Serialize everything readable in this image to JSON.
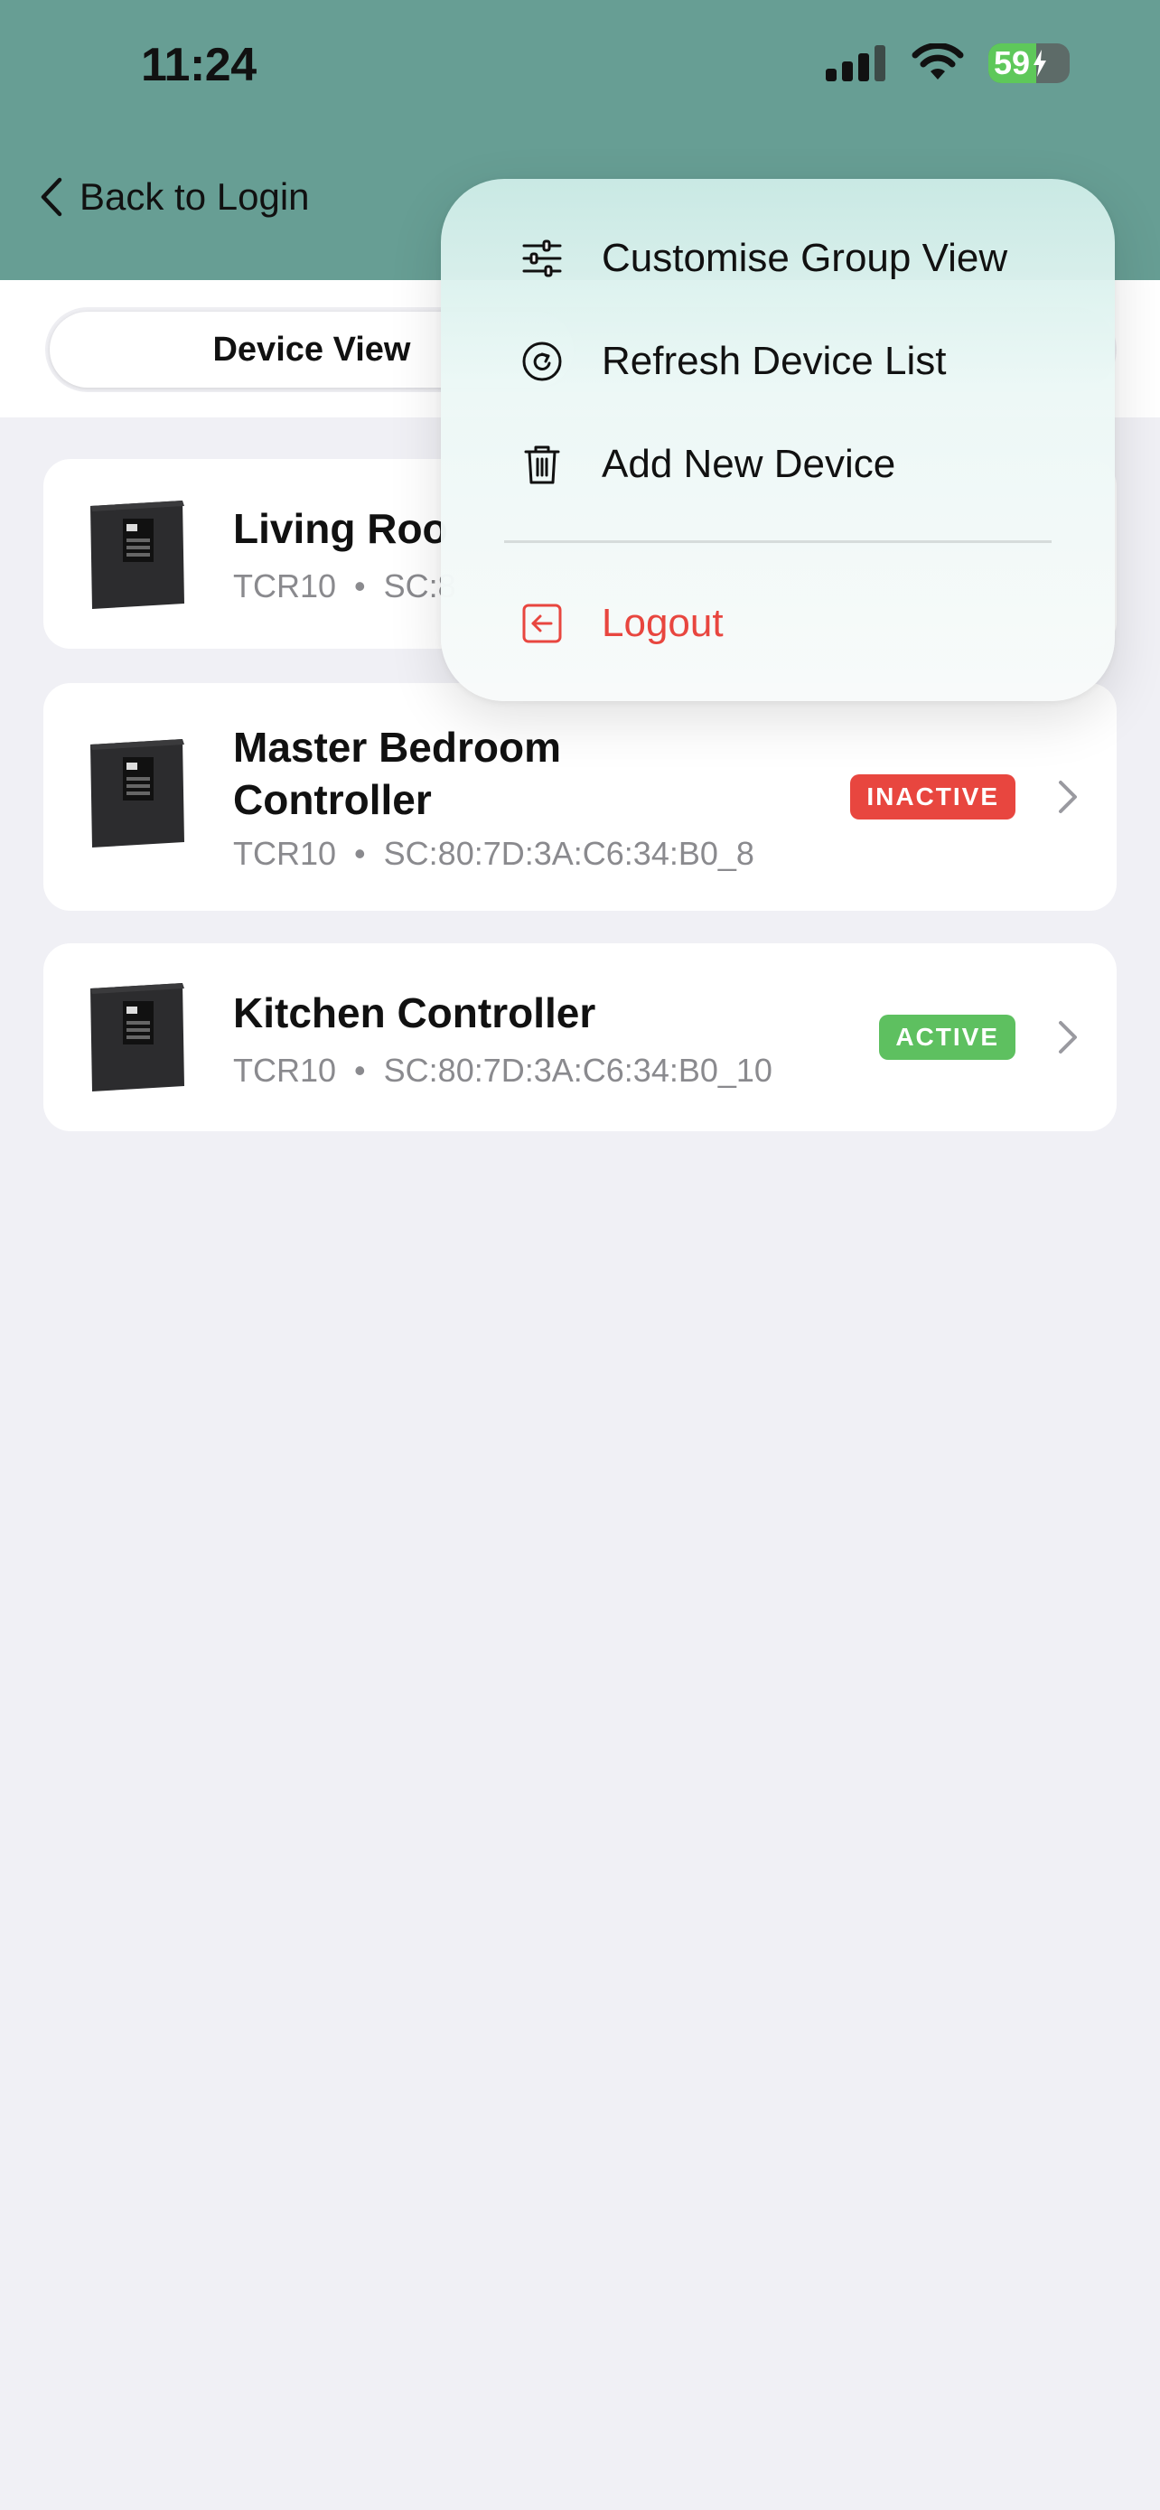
{
  "status_bar": {
    "time": "11:24",
    "battery_level": "59"
  },
  "header": {
    "back_label": "Back to Login"
  },
  "segment": {
    "active_label": "Device View"
  },
  "devices": [
    {
      "name": "Living Roo",
      "model": "TCR10",
      "serial_prefix": "SC:8",
      "status": "",
      "status_color": "#e8463f"
    },
    {
      "name_line1": "Master Bedroom",
      "name_line2": "Controller",
      "model": "TCR10",
      "separator": "•",
      "serial": "SC:80:7D:3A:C6:34:B0_8",
      "status": "INACTIVE",
      "status_color": "#e8463f"
    },
    {
      "name": "Kitchen Controller",
      "model": "TCR10",
      "separator": "•",
      "serial": "SC:80:7D:3A:C6:34:B0_10",
      "status": "ACTIVE",
      "status_color": "#5ec060"
    }
  ],
  "menu": {
    "items": [
      {
        "label": "Customise Group View",
        "icon": "sliders-icon"
      },
      {
        "label": "Refresh Device List",
        "icon": "refresh-icon"
      },
      {
        "label": "Add New Device",
        "icon": "trash-icon"
      }
    ],
    "logout": {
      "label": "Logout",
      "icon": "logout-icon",
      "color": "#e8463f"
    }
  },
  "colors": {
    "header": "#679e94",
    "background": "#f0f0f5",
    "active": "#5ec060",
    "inactive": "#e8463f"
  }
}
